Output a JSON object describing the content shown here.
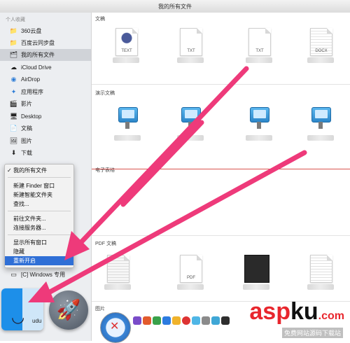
{
  "window": {
    "title": "我的所有文件"
  },
  "sidebar": {
    "section_label": "个人收藏",
    "items": [
      {
        "label": "360云盘",
        "icon": "folder-icon"
      },
      {
        "label": "百度云同步盘",
        "icon": "folder-icon"
      },
      {
        "label": "我的所有文件",
        "icon": "all-files-icon",
        "selected": true
      },
      {
        "label": "iCloud Drive",
        "icon": "cloud-icon"
      },
      {
        "label": "AirDrop",
        "icon": "airdrop-icon"
      },
      {
        "label": "应用程序",
        "icon": "apps-icon"
      },
      {
        "label": "影片",
        "icon": "film-icon"
      },
      {
        "label": "Desktop",
        "icon": "desktop-icon"
      },
      {
        "label": "文稿",
        "icon": "document-icon"
      },
      {
        "label": "图片",
        "icon": "picture-icon"
      },
      {
        "label": "下载",
        "icon": "download-icon"
      },
      {
        "label": "[C] Windows 专用",
        "icon": "drive-icon"
      }
    ]
  },
  "main": {
    "sections": [
      {
        "title": "文稿",
        "files": [
          "TEXT",
          "TXT",
          "TXT",
          "DOCX"
        ]
      },
      {
        "title": "演示文稿"
      },
      {
        "title": "电子表格"
      },
      {
        "title": "PDF 文稿",
        "files": [
          "",
          "PDF",
          "",
          ""
        ]
      },
      {
        "title": "图片"
      }
    ]
  },
  "context_menu": {
    "items": [
      {
        "label": "我的所有文件",
        "checked": true
      },
      {
        "label": "新建 Finder 窗口"
      },
      {
        "label": "新建智能文件夹"
      },
      {
        "label": "查找..."
      },
      {
        "label": "前往文件夹..."
      },
      {
        "label": "连接服务器..."
      },
      {
        "label": "显示所有窗口"
      },
      {
        "label": "隐藏"
      },
      {
        "label": "重新开启",
        "active": true
      }
    ]
  },
  "dock": {
    "partial_label": "udu"
  },
  "watermark": {
    "brand_a": "asp",
    "brand_b": "ku",
    "brand_c": ".com",
    "sub": "免费网站源码下载站"
  },
  "colors": {
    "arrow": "#ee3a7a",
    "menu_highlight": "#2f6fd6",
    "divider_red": "#d9534f"
  }
}
